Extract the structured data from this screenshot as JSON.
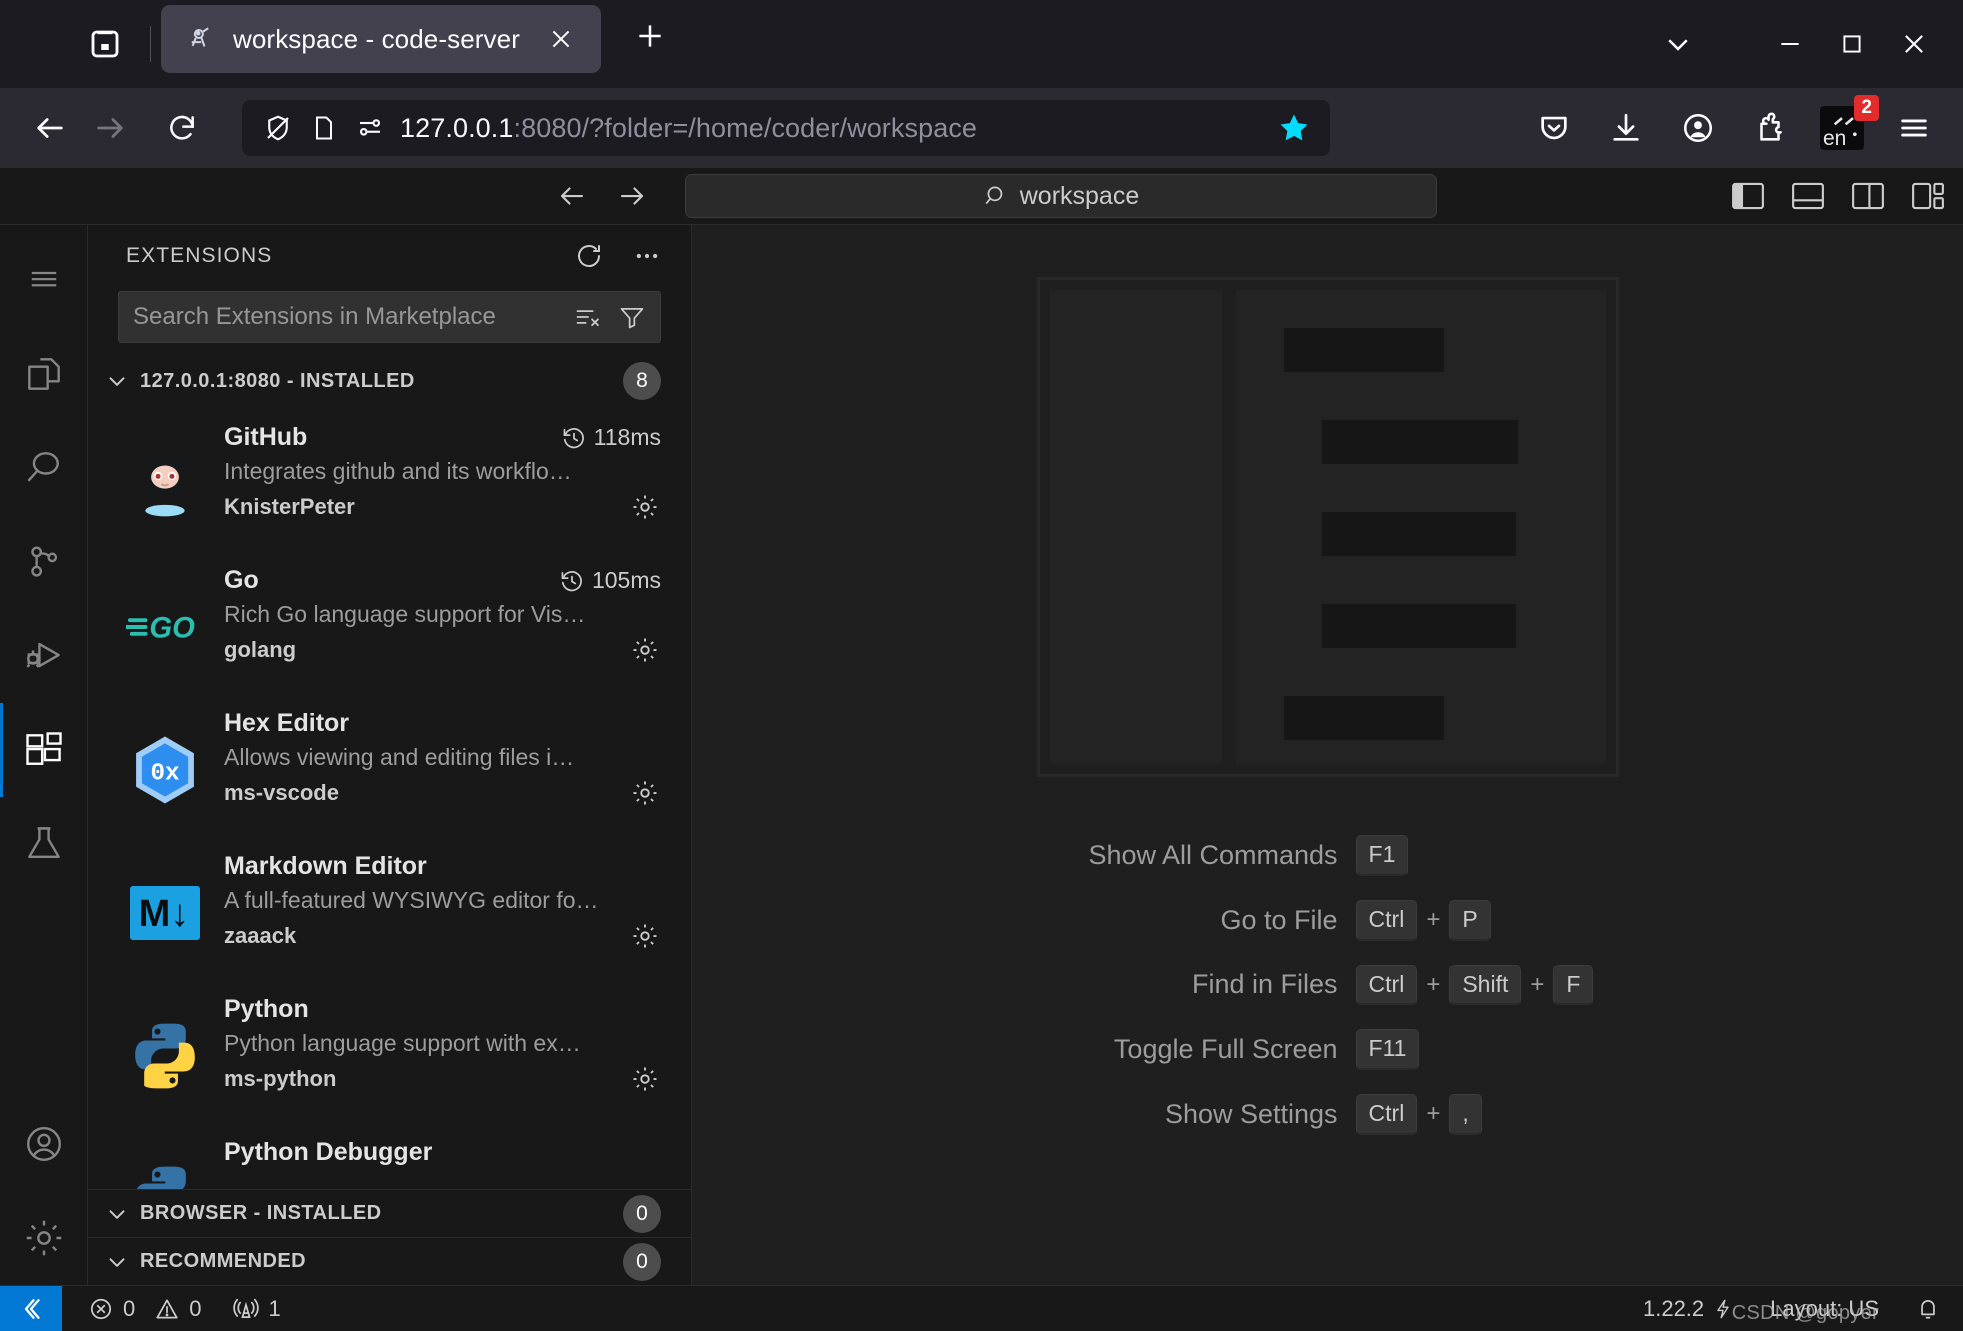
{
  "browser": {
    "firefox_view_icon": "firefox-view-icon",
    "tab": {
      "favicon": "code-server-favicon",
      "title": "workspace - code-server",
      "close_icon": "close-icon"
    },
    "new_tab_icon": "plus-icon",
    "window_controls": {
      "list_all_tabs_icon": "chevron-down-icon",
      "minimize_icon": "minimize-icon",
      "maximize_icon": "maximize-icon",
      "close_icon": "close-icon"
    },
    "nav": {
      "back_icon": "back-arrow-icon",
      "forward_icon": "forward-arrow-icon",
      "reload_icon": "reload-icon"
    },
    "urlbar": {
      "shield_icon": "shield-off-icon",
      "page_icon": "page-icon",
      "permissions_icon": "permissions-icon",
      "host": "127.0.0.1",
      "path": ":8080/?folder=/home/coder/workspace",
      "bookmark_icon": "star-filled-icon",
      "bookmark_color": "#00ddff"
    },
    "toolbar_right": [
      {
        "name": "pocket-icon",
        "label": "Pocket"
      },
      {
        "name": "downloads-icon",
        "label": "Downloads"
      },
      {
        "name": "account-icon",
        "label": "Account"
      },
      {
        "name": "extensions-icon",
        "label": "Extensions"
      }
    ],
    "ime": {
      "label": "en",
      "badge": "2",
      "badge_color": "#e22b2b"
    },
    "app_menu_icon": "hamburger-menu-icon"
  },
  "vscode": {
    "titlebar": {
      "back_icon": "back-arrow-icon",
      "forward_icon": "forward-arrow-icon",
      "command_center": {
        "search_icon": "search-icon",
        "text": "workspace"
      },
      "layout_controls": [
        {
          "name": "toggle-primary-sidebar-icon",
          "label": "Toggle Primary Side Bar"
        },
        {
          "name": "toggle-panel-icon",
          "label": "Toggle Panel"
        },
        {
          "name": "toggle-secondary-sidebar-icon",
          "label": "Toggle Secondary Side Bar"
        },
        {
          "name": "customize-layout-icon",
          "label": "Customize Layout"
        }
      ]
    },
    "activitybar": [
      {
        "name": "menu-icon",
        "label": "Menu",
        "active": false
      },
      {
        "name": "explorer-icon",
        "label": "Explorer",
        "active": false
      },
      {
        "name": "search-icon",
        "label": "Search",
        "active": false
      },
      {
        "name": "source-control-icon",
        "label": "Source Control",
        "active": false
      },
      {
        "name": "run-and-debug-icon",
        "label": "Run and Debug",
        "active": false
      },
      {
        "name": "extensions-icon",
        "label": "Extensions",
        "active": true
      },
      {
        "name": "testing-icon",
        "label": "Testing",
        "active": false
      }
    ],
    "activitybar_bottom": [
      {
        "name": "accounts-icon",
        "label": "Accounts"
      },
      {
        "name": "settings-gear-icon",
        "label": "Manage"
      }
    ],
    "sidebar": {
      "title": "EXTENSIONS",
      "actions": [
        {
          "name": "refresh-icon",
          "label": "Refresh"
        },
        {
          "name": "views-and-more-actions-icon",
          "label": "Views and More Actions..."
        }
      ],
      "search": {
        "placeholder": "Search Extensions in Marketplace",
        "value": "",
        "clear_filter_icon": "clear-filter-icon",
        "filter_icon": "filter-icon"
      },
      "sections": [
        {
          "name": "installed",
          "label": "127.0.0.1:8080 - INSTALLED",
          "count": "8",
          "expanded": true
        },
        {
          "name": "browser-installed",
          "label": "BROWSER - INSTALLED",
          "count": "0",
          "expanded": true
        },
        {
          "name": "recommended",
          "label": "RECOMMENDED",
          "count": "0",
          "expanded": true
        }
      ],
      "extensions": [
        {
          "name": "GitHub",
          "description": "Integrates github and its workflo…",
          "publisher": "KnisterPeter",
          "activation_time": "118ms",
          "icon": "github-octocat-icon",
          "gear_icon": "gear-icon"
        },
        {
          "name": "Go",
          "description": "Rich Go language support for Vis…",
          "publisher": "golang",
          "activation_time": "105ms",
          "icon": "go-gopher-icon",
          "gear_icon": "gear-icon"
        },
        {
          "name": "Hex Editor",
          "description": "Allows viewing and editing files i…",
          "publisher": "ms-vscode",
          "activation_time": "",
          "icon": "hex-editor-icon",
          "gear_icon": "gear-icon"
        },
        {
          "name": "Markdown Editor",
          "description": "A full-featured WYSIWYG editor fo…",
          "publisher": "zaaack",
          "activation_time": "",
          "icon": "markdown-icon",
          "gear_icon": "gear-icon"
        },
        {
          "name": "Python",
          "description": "Python language support with ex…",
          "publisher": "ms-python",
          "activation_time": "",
          "icon": "python-icon",
          "gear_icon": "gear-icon"
        },
        {
          "name": "Python Debugger",
          "description": "",
          "publisher": "",
          "activation_time": "",
          "icon": "python-debugger-icon",
          "gear_icon": "gear-icon"
        }
      ]
    },
    "editor": {
      "watermark_image_name": "empty-editor-placeholder",
      "shortcuts": [
        {
          "label": "Show All Commands",
          "keys": [
            "F1"
          ]
        },
        {
          "label": "Go to File",
          "keys": [
            "Ctrl",
            "P"
          ]
        },
        {
          "label": "Find in Files",
          "keys": [
            "Ctrl",
            "Shift",
            "F"
          ]
        },
        {
          "label": "Toggle Full Screen",
          "keys": [
            "F11"
          ]
        },
        {
          "label": "Show Settings",
          "keys": [
            "Ctrl",
            ","
          ]
        }
      ]
    },
    "statusbar": {
      "remote_icon": "remote-window-icon",
      "remote_color": "#0078d4",
      "problems": [
        {
          "icon": "error-icon",
          "value": "0"
        },
        {
          "icon": "warning-icon",
          "value": "0"
        }
      ],
      "ports": {
        "icon": "ports-icon",
        "value": "1"
      },
      "right": [
        {
          "name": "version",
          "icon": "",
          "value": "1.22.2"
        },
        {
          "name": "lightning",
          "icon": "lightning-icon",
          "value": ""
        },
        {
          "name": "keyboard-layout",
          "icon": "",
          "value": "Layout: US"
        },
        {
          "name": "notifications",
          "icon": "bell-icon",
          "value": ""
        }
      ]
    }
  },
  "overlay": {
    "watermark": "CSDN @gopyer"
  }
}
